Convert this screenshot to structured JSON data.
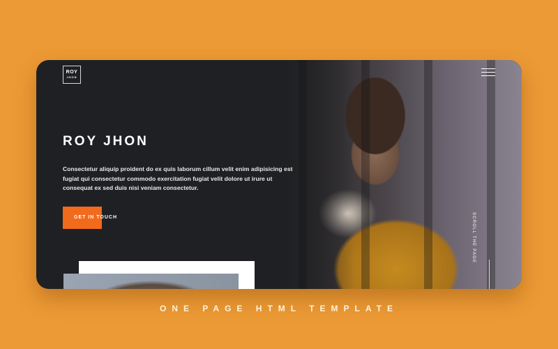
{
  "site": {
    "logo": {
      "line1": "ROY",
      "line2": "JHON"
    },
    "menu_icon": "hamburger-icon"
  },
  "hero": {
    "title": "ROY JHON",
    "description": "Consectetur aliquip proident do ex quis laborum cillum velit enim adipisicing est fugiat qui consectetur commodo exercitation fugiat velit dolore ut irure ut consequat ex sed duis nisi veniam consectetur.",
    "cta_label": "GET IN TOUCH",
    "scroll_label": "SCROLL THE PAGE"
  },
  "colors": {
    "background": "#ec9a35",
    "accent": "#f26a1b",
    "card": "#1f2023"
  },
  "footer": {
    "caption": "ONE PAGE HTML TEMPLATE"
  }
}
